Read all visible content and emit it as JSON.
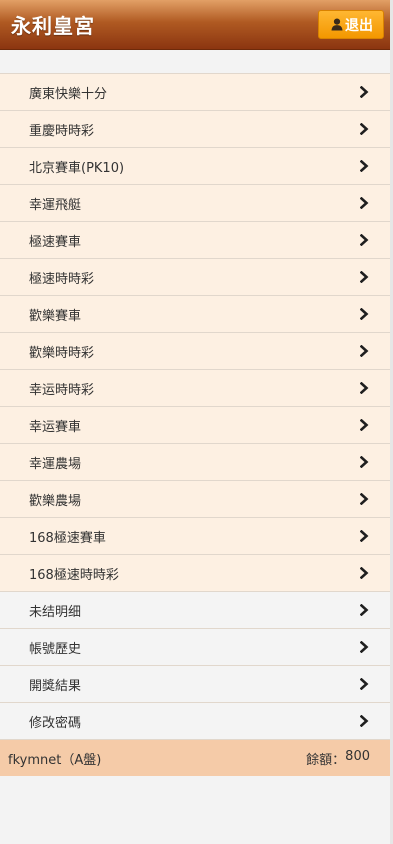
{
  "header": {
    "title": "永利皇宮",
    "logout_label": "退出"
  },
  "menu": {
    "games": [
      {
        "label": "廣東快樂十分"
      },
      {
        "label": "重慶時時彩"
      },
      {
        "label": "北京賽車(PK10)"
      },
      {
        "label": "幸運飛艇"
      },
      {
        "label": "極速賽車"
      },
      {
        "label": "極速時時彩"
      },
      {
        "label": "歡樂賽車"
      },
      {
        "label": "歡樂時時彩"
      },
      {
        "label": "幸运時時彩"
      },
      {
        "label": "幸运賽車"
      },
      {
        "label": "幸運農場"
      },
      {
        "label": "歡樂農場"
      },
      {
        "label": "168極速賽車"
      },
      {
        "label": "168極速時時彩"
      }
    ],
    "account": [
      {
        "label": "未结明细"
      },
      {
        "label": "帳號歷史"
      },
      {
        "label": "開獎結果"
      },
      {
        "label": "修改密碼"
      }
    ]
  },
  "footer": {
    "account": "fkymnet（A盤)",
    "balance_label": "餘額：",
    "balance_value": "800"
  },
  "colors": {
    "header_gradient": [
      "#e2a066",
      "#b05a22",
      "#8b3510"
    ],
    "logout_button": "#f39700",
    "game_item_bg": "#fdf0e2",
    "account_item_bg": "#f4f4f4",
    "footer_bg": "#f5cba8"
  },
  "icons": {
    "logout": "user-icon",
    "item_arrow": "chevron-right-icon"
  }
}
